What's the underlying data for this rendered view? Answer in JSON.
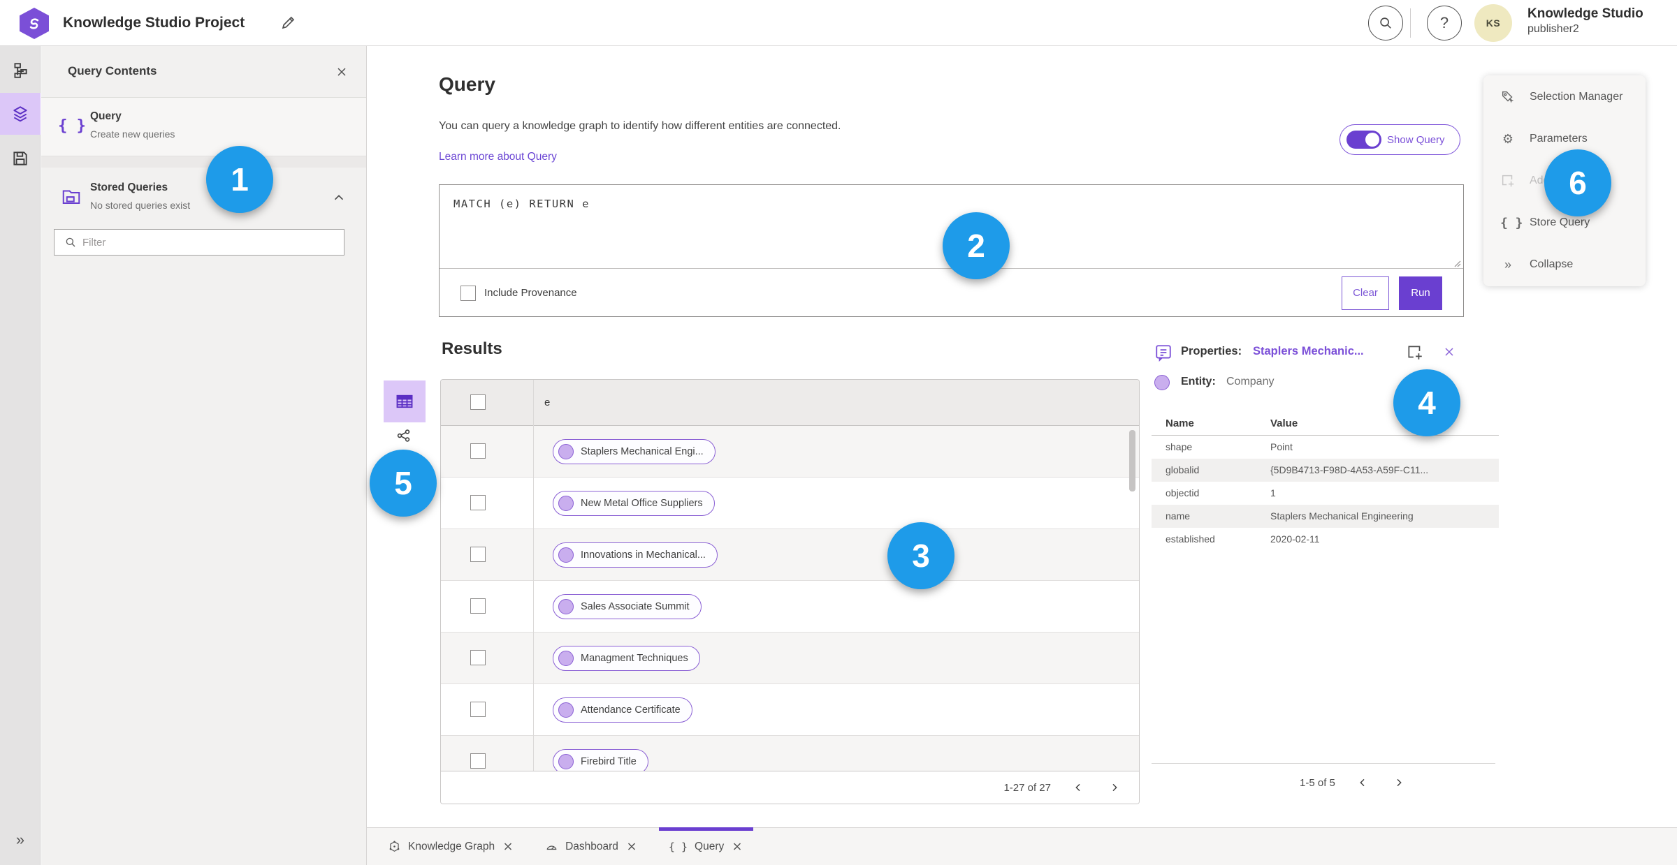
{
  "colors": {
    "accent_purple": "#6a3fd0",
    "lavender_selected": "#dcc7f8",
    "pill_border": "#8a5fd4",
    "link_purple": "#6b46d4",
    "annotation_blue": "#1e9be9"
  },
  "header": {
    "title": "Knowledge Studio Project",
    "user": {
      "initials": "KS",
      "name": "Knowledge Studio",
      "role": "publisher2"
    }
  },
  "left_panel": {
    "title": "Query Contents",
    "query_item": {
      "title": "Query",
      "subtitle": "Create new queries"
    },
    "stored_item": {
      "title": "Stored Queries",
      "subtitle": "No stored queries exist"
    },
    "filter_placeholder": "Filter"
  },
  "query": {
    "title": "Query",
    "description": "You can query a knowledge graph to identify how different entities are connected.",
    "learn_more": "Learn more about Query",
    "show_query": "Show Query",
    "text": "MATCH (e) RETURN e",
    "include_provenance": "Include Provenance",
    "clear": "Clear",
    "run": "Run"
  },
  "results": {
    "title": "Results",
    "column": "e",
    "rows": [
      "Staplers Mechanical Engi...",
      "New Metal Office Suppliers",
      "Innovations in Mechanical...",
      "Sales Associate Summit",
      "Managment Techniques",
      "Attendance Certificate",
      "Firebird Title"
    ],
    "pagination": "1-27 of 27"
  },
  "properties": {
    "label": "Properties:",
    "selected": "Staplers Mechanic...",
    "entity_label": "Entity:",
    "entity_type": "Company",
    "col_name": "Name",
    "col_value": "Value",
    "rows": [
      {
        "name": "shape",
        "value": "Point"
      },
      {
        "name": "globalid",
        "value": "{5D9B4713-F98D-4A53-A59F-C11..."
      },
      {
        "name": "objectid",
        "value": "1"
      },
      {
        "name": "name",
        "value": "Staplers Mechanical Engineering"
      },
      {
        "name": "established",
        "value": "2020-02-11"
      }
    ],
    "pagination": "1-5 of 5"
  },
  "side_menu": {
    "items": [
      {
        "label": "Selection Manager"
      },
      {
        "label": "Parameters"
      },
      {
        "label": "Add To Map"
      },
      {
        "label": "Store Query"
      },
      {
        "label": "Collapse"
      }
    ]
  },
  "tabs": [
    {
      "label": "Knowledge Graph"
    },
    {
      "label": "Dashboard"
    },
    {
      "label": "Query"
    }
  ],
  "annotations": {
    "n1": "1",
    "n2": "2",
    "n3": "3",
    "n4": "4",
    "n5": "5",
    "n6": "6"
  }
}
